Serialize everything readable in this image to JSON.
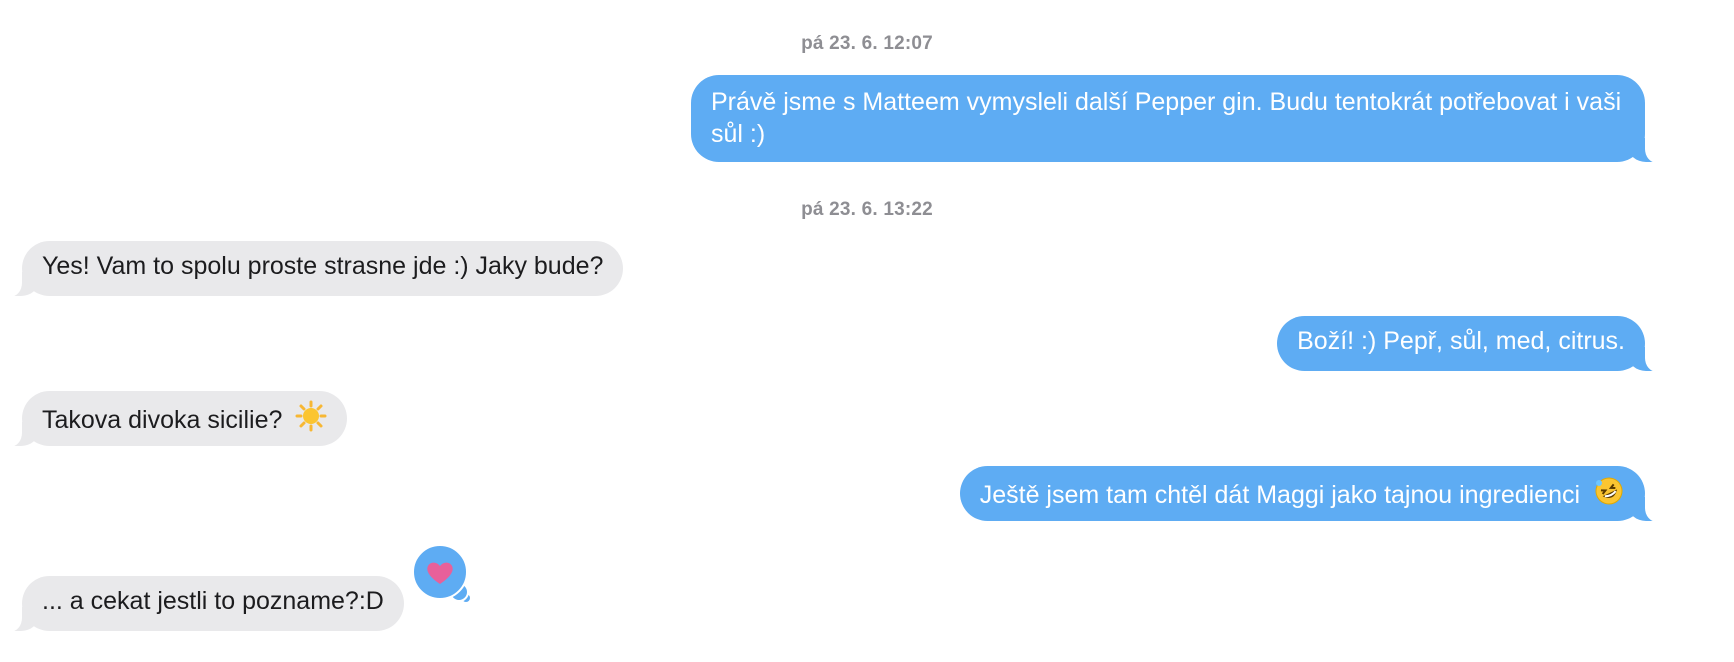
{
  "timestamps": [
    "pá 23. 6. 12:07",
    "pá 23. 6. 13:22"
  ],
  "messages": [
    {
      "direction": "sent",
      "text": "Právě jsme s Matteem vymysleli další Pepper gin. Budu tentokrát potřebovat i vaši sůl :)"
    },
    {
      "direction": "received",
      "text": "Yes! Vam to spolu proste strasne jde :) Jaky bude?"
    },
    {
      "direction": "sent",
      "text": "Boží! :) Pepř, sůl, med, citrus."
    },
    {
      "direction": "received",
      "text": "Takova divoka sicilie?",
      "emoji": "sun-emoji"
    },
    {
      "direction": "sent",
      "text": "Ještě jsem tam chtěl dát Maggi jako tajnou ingredienci",
      "emoji": "rofl-emoji"
    },
    {
      "direction": "received",
      "text": "... a cekat jestli to pozname?:D",
      "reaction": "heart-icon"
    }
  ],
  "colors": {
    "sent_bubble": "#5eacf3",
    "received_bubble": "#e9e9eb",
    "timestamp": "#8e8e93",
    "heart": "#e8609a"
  }
}
